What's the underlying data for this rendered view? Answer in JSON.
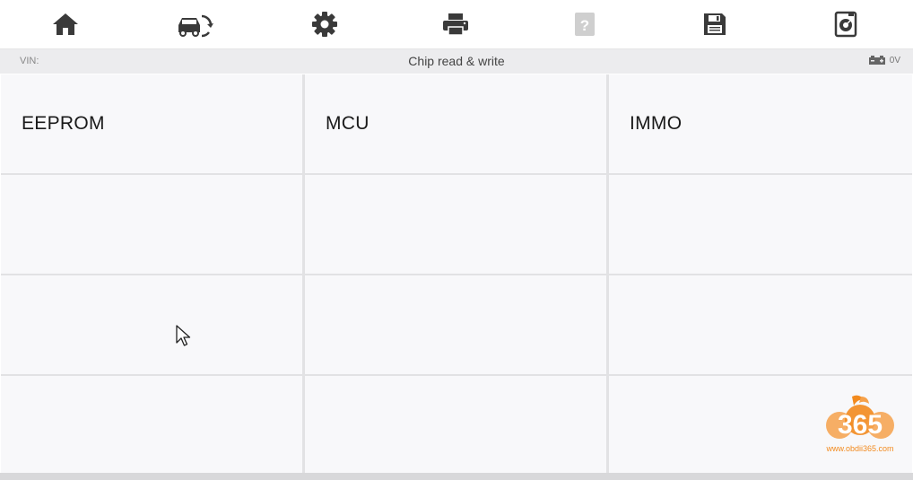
{
  "toolbar": {
    "items": [
      {
        "icon": "home-icon"
      },
      {
        "icon": "vehicle-swap-icon"
      },
      {
        "icon": "gear-icon"
      },
      {
        "icon": "printer-icon"
      },
      {
        "icon": "help-icon"
      },
      {
        "icon": "save-icon"
      },
      {
        "icon": "screen-record-icon"
      }
    ]
  },
  "status": {
    "vin_label": "VIN:",
    "title": "Chip read & write",
    "voltage": "0V"
  },
  "grid": {
    "cells": [
      {
        "label": "EEPROM"
      },
      {
        "label": "MCU"
      },
      {
        "label": "IMMO"
      },
      {
        "label": ""
      },
      {
        "label": ""
      },
      {
        "label": ""
      },
      {
        "label": ""
      },
      {
        "label": ""
      },
      {
        "label": ""
      },
      {
        "label": ""
      },
      {
        "label": ""
      },
      {
        "label": ""
      }
    ]
  },
  "watermark": {
    "logo_text": "365",
    "site": "www.obdii365.com"
  },
  "colors": {
    "icon": "#3a3a3a",
    "icon_disabled": "#c8c8c8",
    "logo_orange": "#f28a1e"
  }
}
